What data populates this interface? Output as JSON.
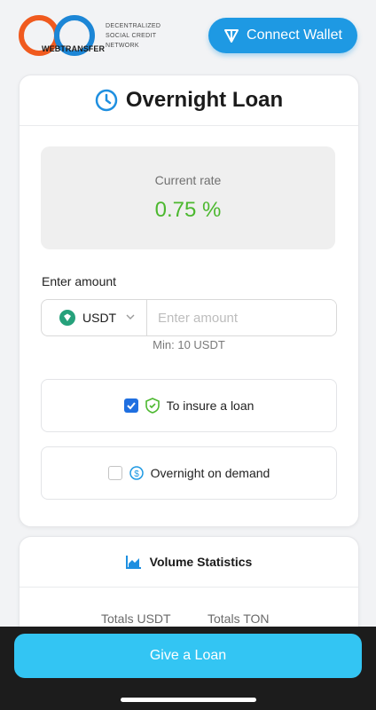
{
  "header": {
    "logo_text": "WEBTRANSFER",
    "tagline": [
      "DECENTRALIZED",
      "SOCIAL CREDIT",
      "NETWORK"
    ],
    "connect_label": "Connect Wallet"
  },
  "loan_card": {
    "title": "Overnight Loan",
    "rate_label": "Current rate",
    "rate_value": "0.75 %",
    "amount_label": "Enter amount",
    "currency": "USDT",
    "amount_placeholder": "Enter amount",
    "amount_value": "",
    "min_text": "Min: 10 USDT",
    "options": [
      {
        "label": "To insure a loan",
        "checked": true
      },
      {
        "label": "Overnight on demand",
        "checked": false
      }
    ]
  },
  "stats_card": {
    "title": "Volume Statistics",
    "columns": [
      "Totals USDT",
      "Totals TON"
    ]
  },
  "footer": {
    "give_label": "Give a Loan"
  },
  "colors": {
    "accent_blue": "#1e99e3",
    "rate_green": "#4cb82f",
    "give_button": "#33c5f3",
    "logo_orange": "#f05a1e",
    "logo_blue": "#1c86d6",
    "usdt_teal": "#26a17b"
  },
  "icons": {
    "connect": "ton-diamond-icon",
    "title": "clock-icon",
    "currency": "usdt-icon",
    "insure": "shield-check-icon",
    "on_demand": "dollar-circle-icon",
    "stats": "area-chart-icon"
  }
}
